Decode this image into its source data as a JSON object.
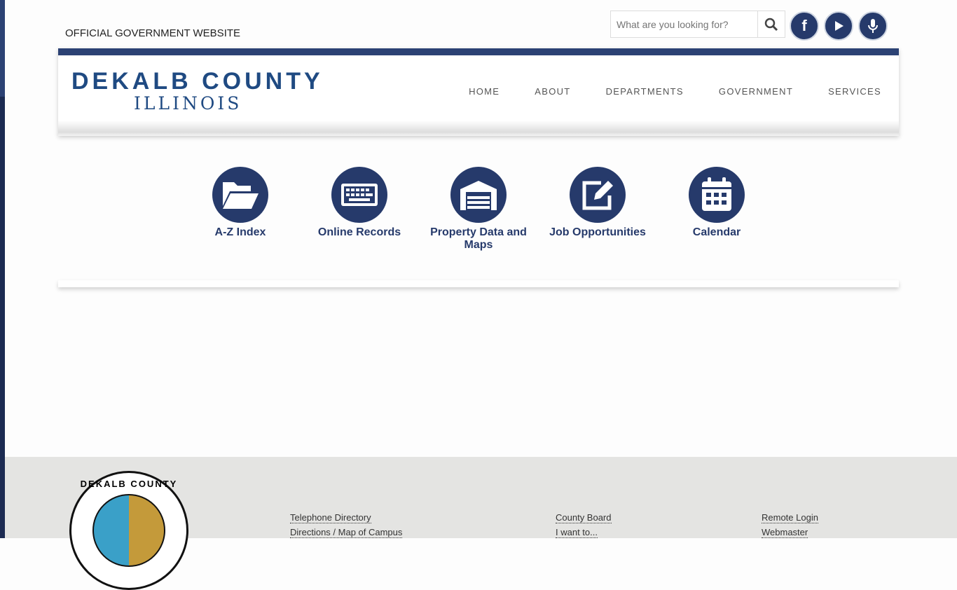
{
  "top": {
    "official": "OFFICIAL GOVERNMENT WEBSITE",
    "search_placeholder": "What are you looking for?"
  },
  "social": [
    "facebook-icon",
    "youtube-icon",
    "microphone-icon"
  ],
  "logo": {
    "line1": "DEKALB COUNTY",
    "line2": "ILLINOIS"
  },
  "nav": [
    "HOME",
    "ABOUT",
    "DEPARTMENTS",
    "GOVERNMENT",
    "SERVICES"
  ],
  "quick_links": [
    {
      "label": "A-Z Index",
      "icon": "folder-open-icon"
    },
    {
      "label": "Online Records",
      "icon": "keyboard-icon"
    },
    {
      "label": "Property Data and Maps",
      "icon": "garage-icon"
    },
    {
      "label": "Job Opportunities",
      "icon": "edit-icon"
    },
    {
      "label": "Calendar",
      "icon": "calendar-icon"
    }
  ],
  "footer": {
    "seal_text": "DEKALB COUNTY",
    "col1": [
      "Telephone Directory",
      "Directions / Map of Campus"
    ],
    "col2": [
      "County Board",
      "I want to..."
    ],
    "col3": [
      "Remote Login",
      "Webmaster"
    ]
  },
  "colors": {
    "brand": "#263a6b",
    "logo": "#1f4a82",
    "footer_bg": "#e4e4e2"
  }
}
